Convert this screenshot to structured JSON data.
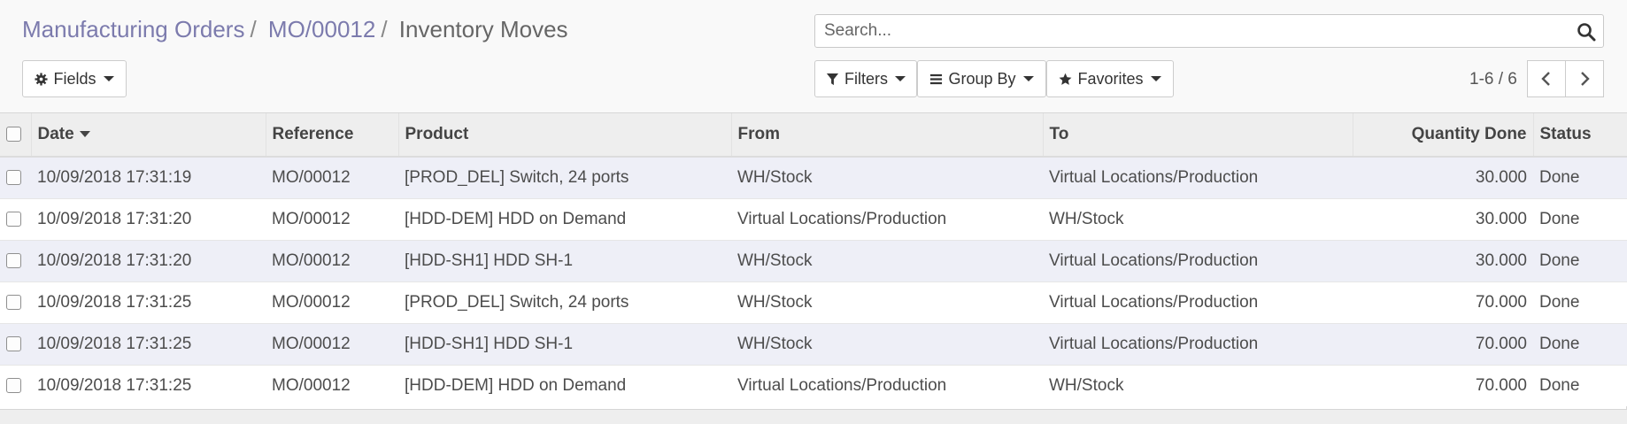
{
  "breadcrumb": {
    "items": [
      "Manufacturing Orders",
      "MO/00012"
    ],
    "separator": "/",
    "active": "Inventory Moves"
  },
  "search": {
    "placeholder": "Search...",
    "icon": "search-icon"
  },
  "buttons": {
    "fields": "Fields",
    "filters": "Filters",
    "group_by": "Group By",
    "favorites": "Favorites"
  },
  "pager": {
    "value": "1-6 / 6"
  },
  "table": {
    "columns": [
      "Date",
      "Reference",
      "Product",
      "From",
      "To",
      "Quantity Done",
      "Status"
    ],
    "sort_column": "Date",
    "rows": [
      [
        "10/09/2018 17:31:19",
        "MO/00012",
        "[PROD_DEL] Switch, 24 ports",
        "WH/Stock",
        "Virtual Locations/Production",
        "30.000",
        "Done"
      ],
      [
        "10/09/2018 17:31:20",
        "MO/00012",
        "[HDD-DEM] HDD on Demand",
        "Virtual Locations/Production",
        "WH/Stock",
        "30.000",
        "Done"
      ],
      [
        "10/09/2018 17:31:20",
        "MO/00012",
        "[HDD-SH1] HDD SH-1",
        "WH/Stock",
        "Virtual Locations/Production",
        "30.000",
        "Done"
      ],
      [
        "10/09/2018 17:31:25",
        "MO/00012",
        "[PROD_DEL] Switch, 24 ports",
        "WH/Stock",
        "Virtual Locations/Production",
        "70.000",
        "Done"
      ],
      [
        "10/09/2018 17:31:25",
        "MO/00012",
        "[HDD-SH1] HDD SH-1",
        "WH/Stock",
        "Virtual Locations/Production",
        "70.000",
        "Done"
      ],
      [
        "10/09/2018 17:31:25",
        "MO/00012",
        "[HDD-DEM] HDD on Demand",
        "Virtual Locations/Production",
        "WH/Stock",
        "70.000",
        "Done"
      ]
    ]
  },
  "colors": {
    "breadcrumb_link": "#7c7bad",
    "odd_row": "#eeeff7",
    "header_bg": "#eeeeee"
  }
}
